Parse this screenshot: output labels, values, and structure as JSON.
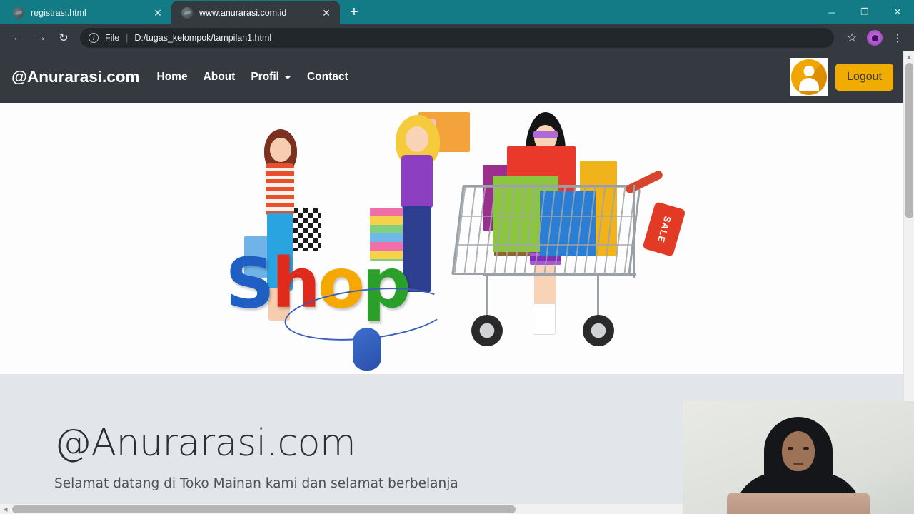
{
  "browser": {
    "tabs": [
      {
        "title": "registrasi.html",
        "active": false,
        "favicon": "globe-icon"
      },
      {
        "title": "www.anurarasi.com.id",
        "active": true,
        "favicon": "globe-icon"
      }
    ],
    "new_tab_label": "+",
    "window_controls": {
      "minimize": "─",
      "maximize": "❐",
      "close": "✕"
    },
    "toolbar": {
      "back": "←",
      "forward": "→",
      "reload": "↻",
      "info_glyph": "i",
      "scheme_label": "File",
      "separator": "|",
      "url": "D:/tugas_kelompok/tampilan1.html",
      "bookmark": "☆",
      "profile": "profile-avatar-icon",
      "menu": "⋮"
    }
  },
  "site": {
    "navbar": {
      "brand": "@Anurarasi.com",
      "links": [
        {
          "label": "Home",
          "dropdown": false
        },
        {
          "label": "About",
          "dropdown": false
        },
        {
          "label": "Profil",
          "dropdown": true
        },
        {
          "label": "Contact",
          "dropdown": false
        }
      ],
      "avatar_alt": "user-avatar-icon",
      "logout_label": "Logout",
      "bg_color": "#343a40",
      "logout_color": "#f0ad00"
    },
    "banner": {
      "alt": "shopping-banner-image",
      "word": [
        "S",
        "h",
        "o",
        "p"
      ],
      "sale_tag": "SALE"
    },
    "jumbotron": {
      "title": "@Anurarasi.com",
      "subtitle": "Selamat datang di Toko Mainan kami dan selamat berbelanja",
      "bg_color": "#e2e5ea"
    },
    "scrollbars": {
      "vertical_arrow": "▲",
      "horizontal_arrow": "◀"
    }
  },
  "overlay": {
    "webcam_alt": "presenter-webcam-feed"
  }
}
